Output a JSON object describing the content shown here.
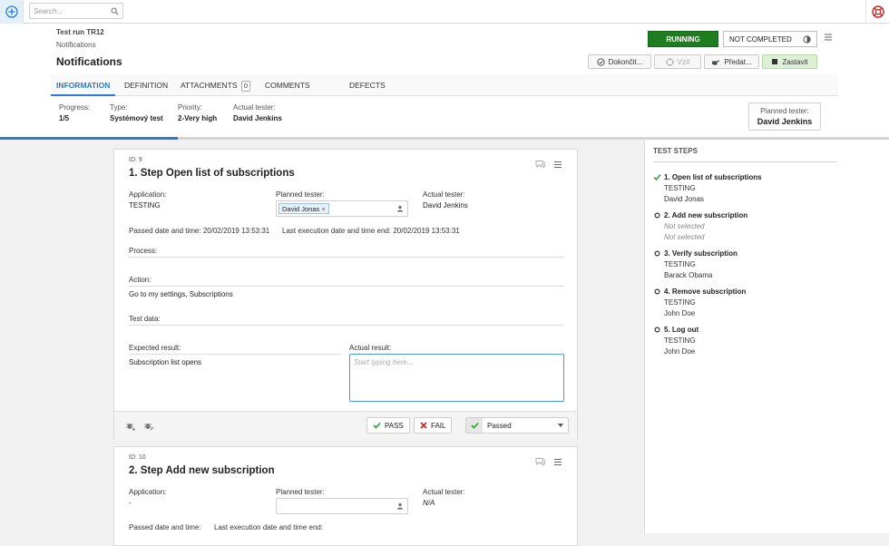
{
  "topbar": {
    "search_placeholder": "Search..."
  },
  "header": {
    "run_id": "Test run TR12",
    "run_subtitle": "Notifications",
    "title": "Notifications",
    "status_running": "RUNNING",
    "status_completion": "NOT COMPLETED",
    "buttons": {
      "finish": "Dokončit...",
      "take": "Vzít",
      "handover": "Předat...",
      "stop": "Zastavit"
    }
  },
  "tabs": [
    {
      "label": "INFORMATION"
    },
    {
      "label": "DEFINITION"
    },
    {
      "label": "ATTACHMENTS",
      "count": "0"
    },
    {
      "label": "COMMENTS"
    },
    {
      "label": "DEFECTS"
    }
  ],
  "info": {
    "progress_label": "Progress:",
    "progress_value": "1/5",
    "progress_fraction": 0.2,
    "type_label": "Type:",
    "type_value": "Systémový test",
    "priority_label": "Priority:",
    "priority_value": "2-Very high",
    "actual_tester_label": "Actual tester:",
    "actual_tester_value": "David Jenkins",
    "planned_tester_label": "Planned tester:",
    "planned_tester_value": "David Jenkins"
  },
  "steps": [
    {
      "id": "ID: 9",
      "title": "1. Step Open list of subscriptions",
      "application_label": "Application:",
      "application": "TESTING",
      "planned_tester_label": "Planned tester:",
      "planned_tester_chip": "David Jonas",
      "actual_tester_label": "Actual tester:",
      "actual_tester": "David Jenkins",
      "passed_label": "Passed date and time:",
      "passed_value": "20/02/2019 13:53:31",
      "last_exec_label": "Last execution date and time end:",
      "last_exec_value": "20/02/2019 13:53:31",
      "process_label": "Process:",
      "action_label": "Action:",
      "action": "Go to my settings, Subscriptions",
      "test_data_label": "Test data:",
      "expected_label": "Expected result:",
      "expected": "Subscription list opens",
      "actual_result_label": "Actual result:",
      "actual_result_placeholder": "Start typing here...",
      "pass_label": "PASS",
      "fail_label": "FAIL",
      "result_value": "Passed"
    },
    {
      "id": "ID: 10",
      "title": "2. Step Add new subscription",
      "application_label": "Application:",
      "application": "-",
      "planned_tester_label": "Planned tester:",
      "actual_tester_label": "Actual tester:",
      "actual_tester": "N/A",
      "passed_label": "Passed date and time:",
      "last_exec_label": "Last execution date and time end:"
    }
  ],
  "steps_panel": {
    "title": "TEST STEPS",
    "items": [
      {
        "title": "1. Open list of subscriptions",
        "line1": "TESTING",
        "line2": "David Jonas",
        "done": true
      },
      {
        "title": "2. Add new subscription",
        "line1": "Not selected",
        "line2": "Not selected",
        "done": false
      },
      {
        "title": "3. Verify subscription",
        "line1": "TESTING",
        "line2": "Barack Obama",
        "done": false
      },
      {
        "title": "4. Remove subscription",
        "line1": "TESTING",
        "line2": "John Doe",
        "done": false
      },
      {
        "title": "5. Log out",
        "line1": "TESTING",
        "line2": "John Doe",
        "done": false
      }
    ]
  },
  "colors": {
    "accent": "#2a7bd0",
    "running": "#1e7d1e",
    "check": "#2e9a2e",
    "fail": "#d02020"
  }
}
